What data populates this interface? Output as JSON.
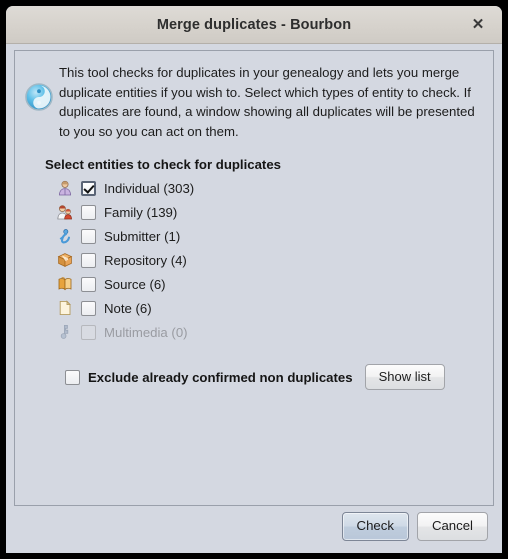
{
  "window": {
    "title": "Merge duplicates - Bourbon",
    "close_label": "✕"
  },
  "info": {
    "icon": "info-circle-icon",
    "text": "This tool checks for duplicates in your genealogy and lets you merge duplicate entities if you wish to. Select which types of entity to check. If duplicates are found, a window showing all duplicates will be presented to you so you can act on them."
  },
  "section": {
    "heading": "Select entities to check for duplicates"
  },
  "entities": [
    {
      "label": "Individual (303)",
      "checked": true,
      "disabled": false,
      "icon": "individual-icon"
    },
    {
      "label": "Family (139)",
      "checked": false,
      "disabled": false,
      "icon": "family-icon"
    },
    {
      "label": "Submitter (1)",
      "checked": false,
      "disabled": false,
      "icon": "submitter-icon"
    },
    {
      "label": "Repository (4)",
      "checked": false,
      "disabled": false,
      "icon": "repository-icon"
    },
    {
      "label": "Source (6)",
      "checked": false,
      "disabled": false,
      "icon": "source-icon"
    },
    {
      "label": "Note (6)",
      "checked": false,
      "disabled": false,
      "icon": "note-icon"
    },
    {
      "label": "Multimedia (0)",
      "checked": false,
      "disabled": true,
      "icon": "multimedia-icon"
    }
  ],
  "exclude": {
    "label": "Exclude already confirmed non duplicates",
    "checked": false,
    "show_list_label": "Show list"
  },
  "footer": {
    "check_label": "Check",
    "cancel_label": "Cancel"
  },
  "colors": {
    "dialog_bg": "#d4d8e1",
    "titlebar_bg": "#d6d2cc",
    "frame_border": "#9aa0ab",
    "default_button": "#bfcddd",
    "text": "#1c1c1c",
    "disabled_text": "#9a9ca2"
  }
}
